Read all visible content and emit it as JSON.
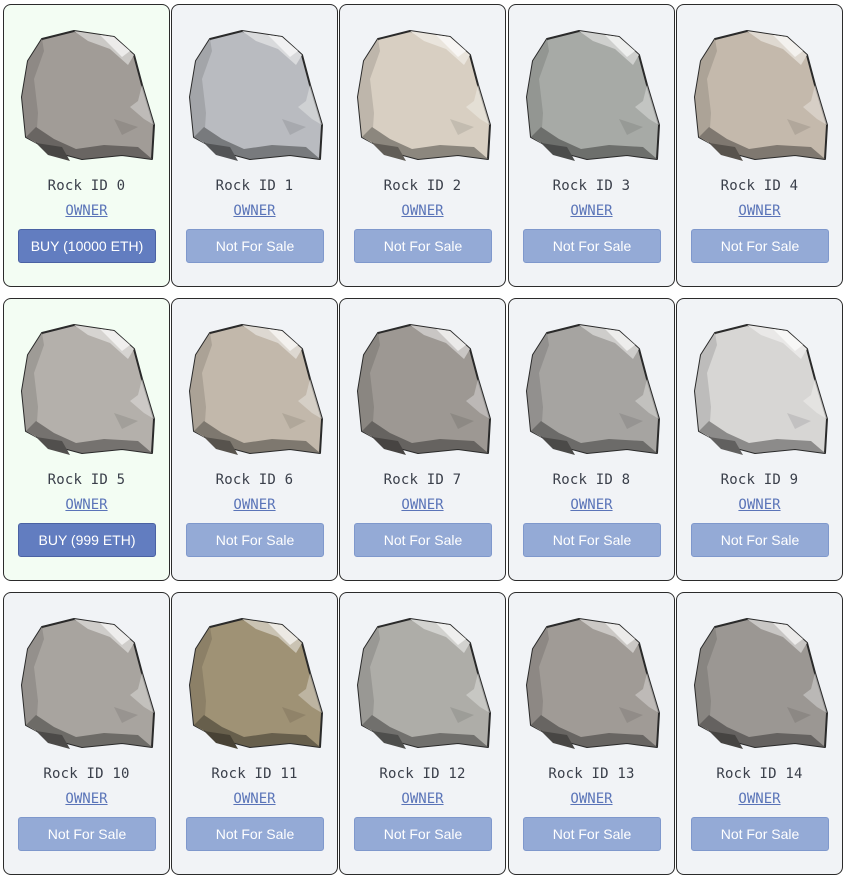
{
  "rocks": [
    {
      "title": "Rock ID 0",
      "owner_label": "OWNER",
      "action_label": "BUY (10000 ETH)",
      "for_sale": true,
      "color": "#a19c97"
    },
    {
      "title": "Rock ID 1",
      "owner_label": "OWNER",
      "action_label": "Not For Sale",
      "for_sale": false,
      "color": "#b9bbc0"
    },
    {
      "title": "Rock ID 2",
      "owner_label": "OWNER",
      "action_label": "Not For Sale",
      "for_sale": false,
      "color": "#d8cfc2"
    },
    {
      "title": "Rock ID 3",
      "owner_label": "OWNER",
      "action_label": "Not For Sale",
      "for_sale": false,
      "color": "#a7aaa6"
    },
    {
      "title": "Rock ID 4",
      "owner_label": "OWNER",
      "action_label": "Not For Sale",
      "for_sale": false,
      "color": "#c4b9ac"
    },
    {
      "title": "Rock ID 5",
      "owner_label": "OWNER",
      "action_label": "BUY (999 ETH)",
      "for_sale": true,
      "color": "#b4b0ab"
    },
    {
      "title": "Rock ID 6",
      "owner_label": "OWNER",
      "action_label": "Not For Sale",
      "for_sale": false,
      "color": "#c2b8ab"
    },
    {
      "title": "Rock ID 7",
      "owner_label": "OWNER",
      "action_label": "Not For Sale",
      "for_sale": false,
      "color": "#9d9893"
    },
    {
      "title": "Rock ID 8",
      "owner_label": "OWNER",
      "action_label": "Not For Sale",
      "for_sale": false,
      "color": "#a6a4a1"
    },
    {
      "title": "Rock ID 9",
      "owner_label": "OWNER",
      "action_label": "Not For Sale",
      "for_sale": false,
      "color": "#d7d6d4"
    },
    {
      "title": "Rock ID 10",
      "owner_label": "OWNER",
      "action_label": "Not For Sale",
      "for_sale": false,
      "color": "#a8a49f"
    },
    {
      "title": "Rock ID 11",
      "owner_label": "OWNER",
      "action_label": "Not For Sale",
      "for_sale": false,
      "color": "#9f9275"
    },
    {
      "title": "Rock ID 12",
      "owner_label": "OWNER",
      "action_label": "Not For Sale",
      "for_sale": false,
      "color": "#aeada8"
    },
    {
      "title": "Rock ID 13",
      "owner_label": "OWNER",
      "action_label": "Not For Sale",
      "for_sale": false,
      "color": "#a09b96"
    },
    {
      "title": "Rock ID 14",
      "owner_label": "OWNER",
      "action_label": "Not For Sale",
      "for_sale": false,
      "color": "#9b9793"
    }
  ],
  "icons": {
    "rock": "rock-icon"
  },
  "colors": {
    "card_bg": "#f1f3f6",
    "card_bg_for_sale": "#f3fdf3",
    "buy_button": "#627dc0",
    "not_for_sale_button": "#94aad6",
    "owner_link": "#5a74b8"
  }
}
